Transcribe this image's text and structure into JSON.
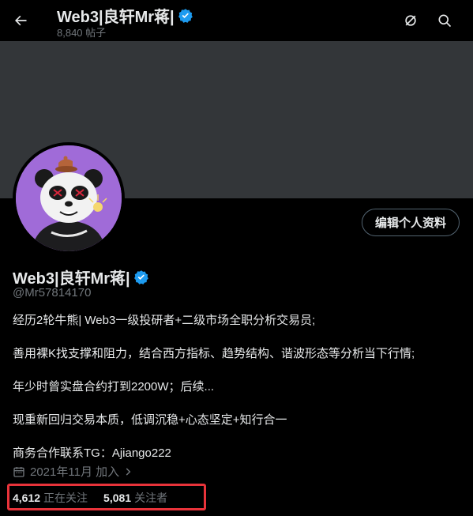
{
  "header": {
    "title": "Web3|良轩Mr蒋|",
    "post_count": "8,840 帖子"
  },
  "profile": {
    "name": "Web3|良轩Mr蒋|",
    "handle": "@Mr57814170",
    "edit_label": "编辑个人资料",
    "bio": [
      "经历2轮牛熊| Web3一级投研者+二级市场全职分析交易员;",
      "善用裸K找支撑和阻力，结合西方指标、趋势结构、谐波形态等分析当下行情;",
      "年少时曾实盘合约打到2200W；后续...",
      "现重新回归交易本质，低调沉稳+心态坚定+知行合一",
      "商务合作联系TG：Ajiango222"
    ],
    "joined": "2021年11月 加入",
    "following_count": "4,612",
    "following_label": "正在关注",
    "followers_count": "5,081",
    "followers_label": "关注者"
  },
  "icons": {
    "back": "arrow-left-icon",
    "verified": "verified-badge-icon",
    "grok": "slash-circle-icon",
    "search": "search-icon",
    "calendar": "calendar-icon",
    "chevron": "chevron-right-icon"
  },
  "colors": {
    "background": "#000000",
    "banner": "#333639",
    "verified": "#1d9bf0",
    "muted_text": "#71767b",
    "highlight_box": "#e8333a",
    "avatar_bg": "#a06bd8"
  }
}
